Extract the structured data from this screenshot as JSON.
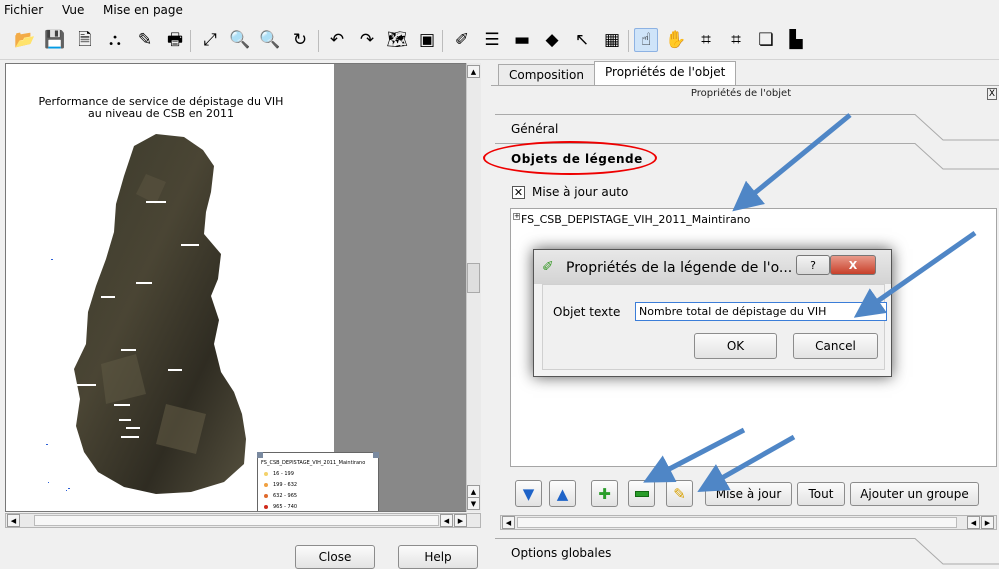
{
  "menu": [
    "Fichier",
    "Vue",
    "Mise en page"
  ],
  "toolbar": {
    "icons": [
      "open-folder-icon",
      "save-template-icon",
      "print-preview-icon",
      "export-pdf-icon",
      "export-svg-icon",
      "print-icon",
      "zoom-full-icon",
      "zoom-in-icon",
      "zoom-out-icon",
      "refresh-icon",
      "undo-icon",
      "redo-icon",
      "add-map-icon",
      "add-image-icon",
      "add-label-icon",
      "add-legend-icon",
      "add-scalebar-icon",
      "add-shape-icon",
      "add-arrow-icon",
      "add-table-icon",
      "select-move-icon",
      "move-content-icon",
      "group-icon",
      "ungroup-icon",
      "raise-icon",
      "align-icon"
    ],
    "glyphs": [
      "📂",
      "💾",
      "🗎",
      "⛬",
      "✎",
      "🖶",
      "⤢",
      "🔍",
      "🔍",
      "↻",
      "↶",
      "↷",
      "🗺",
      "▣",
      "✐",
      "☰",
      "▬",
      "◆",
      "↖",
      "▦",
      "☝",
      "✋",
      "⌗",
      "⌗",
      "❏",
      "▙"
    ],
    "active_index": 20
  },
  "map": {
    "title": "Performance de service de dépistage du VIH au niveau de CSB en 2011",
    "legend_header": "FS_CSB_DEPISTAGE_VIH_2011_Maintirano",
    "legend_rows": [
      {
        "label": "16 - 199",
        "color": "#f4d26b"
      },
      {
        "label": "199 - 632",
        "color": "#f0a040"
      },
      {
        "label": "632 - 965",
        "color": "#e06a2c"
      },
      {
        "label": "965 - 740",
        "color": "#d02a1a"
      },
      {
        "label": "740 - 961",
        "color": "#7a0000"
      }
    ]
  },
  "bottom_buttons": {
    "close": "Close",
    "help": "Help"
  },
  "tabs": {
    "composition": "Composition",
    "item_props": "Propriétés de l'objet"
  },
  "dock": {
    "title": "Propriétés de l'objet",
    "close": "X",
    "general": "Général",
    "legend_items": "Objets de légende",
    "auto_update": "Mise à jour auto",
    "tree_item": "FS_CSB_DEPISTAGE_VIH_2011_Maintirano",
    "update_btn": "Mise à jour",
    "all_btn": "Tout",
    "add_group_btn": "Ajouter un groupe",
    "global_options": "Options globales"
  },
  "dialog": {
    "title": "Propriétés de la légende de l'o...",
    "help": "?",
    "close": "X",
    "field_label": "Objet texte",
    "field_value": "Nombre total de dépistage du VIH",
    "ok": "OK",
    "cancel": "Cancel"
  },
  "colors": {
    "accent_arrow": "#4f86c6",
    "highlight_circle": "#e00000",
    "selection_blue": "#3b7dd8"
  }
}
